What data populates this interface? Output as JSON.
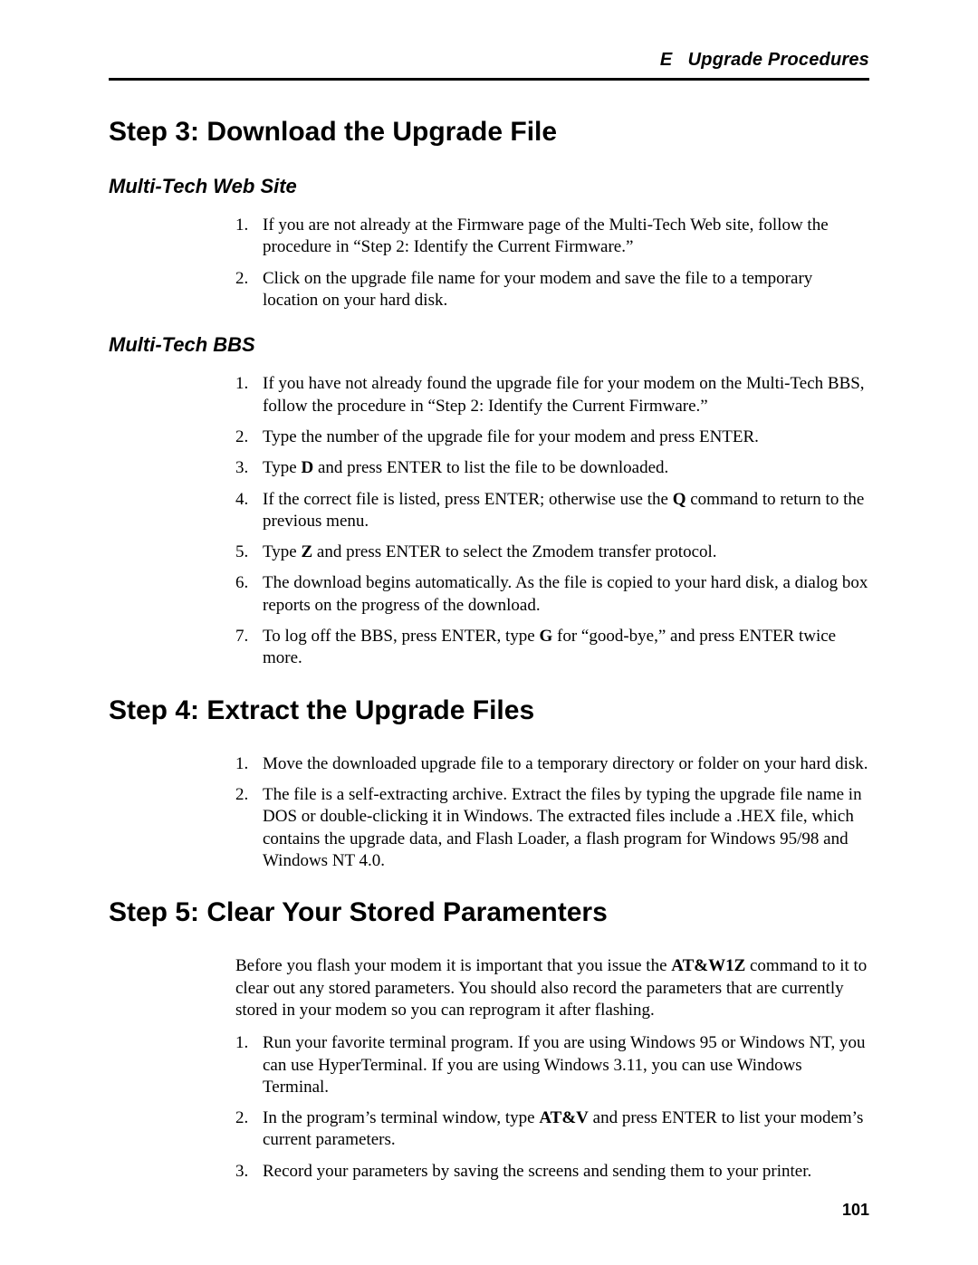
{
  "header": {
    "prefix": "E",
    "title": "Upgrade Procedures"
  },
  "section3": {
    "heading": "Step 3: Download the Upgrade File",
    "sub1": {
      "heading": "Multi-Tech Web Site",
      "items": [
        "If you are not already at the Firmware page of the Multi-Tech Web site, follow the procedure in “Step 2: Identify the Current Firmware.”",
        "Click on the upgrade file name for your modem and save the file to a temporary location on your hard disk."
      ]
    },
    "sub2": {
      "heading": "Multi-Tech BBS",
      "items": [
        "If you have not already found the upgrade file for your modem on the Multi-Tech BBS, follow the procedure in “Step 2: Identify the Current Firmware.”",
        "Type the number of the upgrade file for your modem and press ENTER.",
        {
          "pre": "Type ",
          "bold": "D",
          "post": " and press ENTER to list the file to be downloaded."
        },
        {
          "pre": "If the correct file is listed, press ENTER; otherwise use the ",
          "bold": "Q",
          "post": " command to return to the previous menu."
        },
        {
          "pre": "Type ",
          "bold": "Z",
          "post": " and press ENTER to select the Zmodem transfer protocol."
        },
        "The download begins automatically. As the file is copied to your hard disk, a dialog box reports on the progress of the download.",
        {
          "pre": "To log off the BBS, press ENTER, type ",
          "bold": "G",
          "post": " for “good-bye,” and press ENTER twice more."
        }
      ]
    }
  },
  "section4": {
    "heading": "Step 4: Extract the Upgrade Files",
    "items": [
      "Move the downloaded upgrade file to a temporary directory or folder on your hard disk.",
      "The file is a self-extracting archive. Extract the files by typing the upgrade file name in DOS or double-clicking it in Windows. The extracted files include a .HEX file, which contains the upgrade data, and Flash Loader, a flash program for Windows 95/98 and Windows NT 4.0."
    ]
  },
  "section5": {
    "heading": "Step 5: Clear Your Stored Paramenters",
    "intro": {
      "pre": "Before you flash your modem it is important that you issue the ",
      "bold": "AT&W1Z",
      "post": " command to it to clear out any stored parameters. You should also record the parameters that are currently stored in your modem so you can reprogram it after flashing."
    },
    "items": [
      "Run your favorite terminal program. If you are using Windows 95 or Windows NT, you can use HyperTerminal. If you are using Windows 3.11, you can use Windows Terminal.",
      {
        "pre": "In the program’s terminal window, type ",
        "bold": "AT&V",
        "post": " and press ENTER to list your modem’s current parameters."
      },
      "Record your parameters by saving the screens and sending them to your printer."
    ]
  },
  "pageNumber": "101"
}
